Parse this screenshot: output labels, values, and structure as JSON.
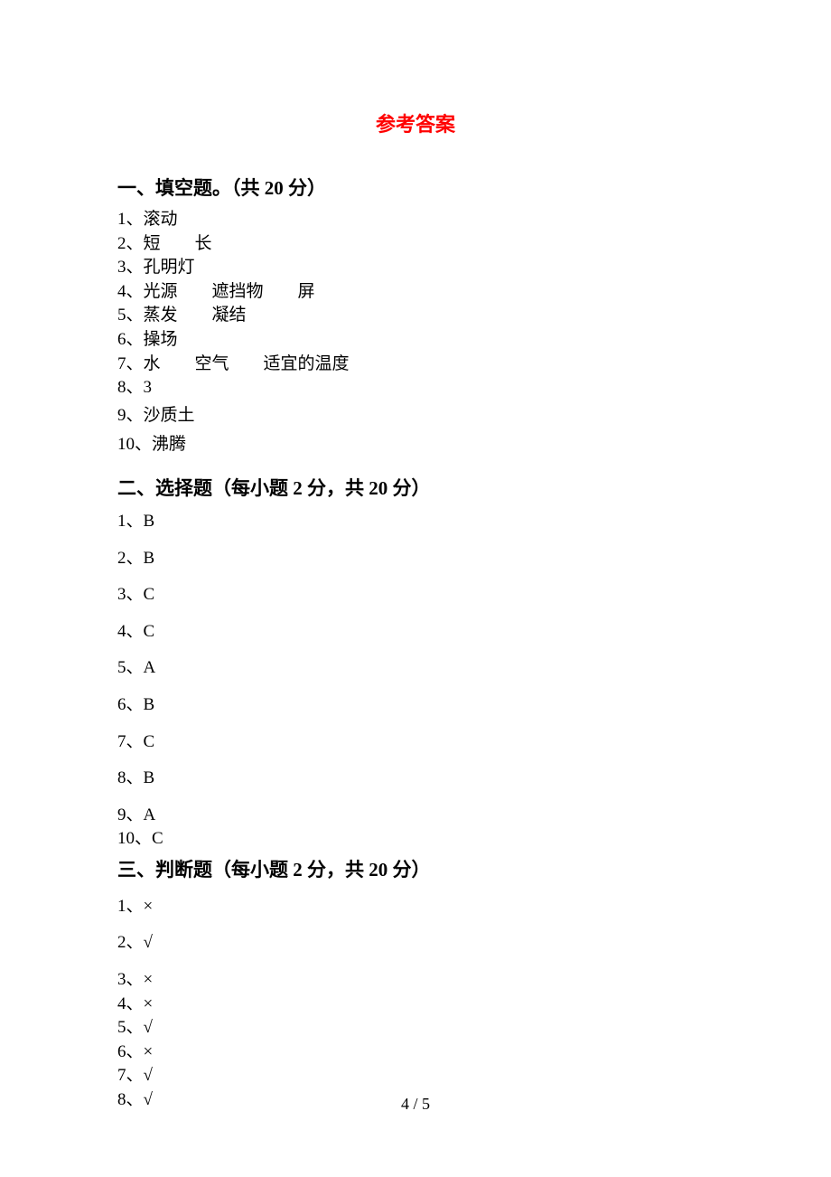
{
  "title": "参考答案",
  "section1": {
    "heading": "一、填空题。（共 20 分）",
    "items": [
      "1、滚动",
      "2、短　　长",
      "3、孔明灯",
      "4、光源　　遮挡物　　屏",
      "5、蒸发　　凝结",
      "6、操场",
      "7、水　　空气　　适宜的温度",
      "8、3",
      "9、沙质土",
      "10、沸腾"
    ]
  },
  "section2": {
    "heading": "二、选择题（每小题 2 分，共 20 分）",
    "items": [
      "1、B",
      "2、B",
      "3、C",
      "4、C",
      "5、A",
      "6、B",
      "7、C",
      "8、B",
      "9、A",
      "10、C"
    ]
  },
  "section3": {
    "heading": "三、判断题（每小题 2 分，共 20 分）",
    "items": [
      "1、×",
      "2、√",
      "3、×",
      "4、×",
      "5、√",
      "6、×",
      "7、√",
      "8、√"
    ]
  },
  "page_number": "4 / 5"
}
